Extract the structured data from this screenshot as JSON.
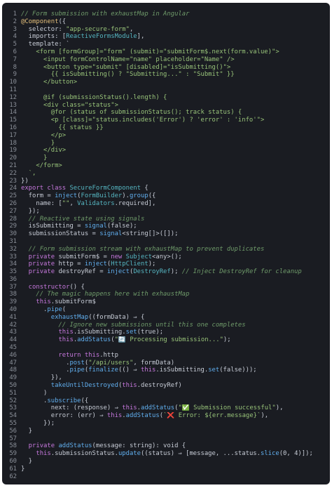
{
  "editor": {
    "lines": [
      {
        "n": "1",
        "tokens": [
          {
            "t": "// Form submission with exhaustMap in Angular",
            "c": "cm"
          }
        ]
      },
      {
        "n": "2",
        "tokens": [
          {
            "t": "@Component",
            "c": "dc"
          },
          {
            "t": "({",
            "c": "pl"
          }
        ]
      },
      {
        "n": "3",
        "tokens": [
          {
            "t": "  selector: ",
            "c": "pl"
          },
          {
            "t": "\"app-secure-form\"",
            "c": "st"
          },
          {
            "t": ",",
            "c": "pl"
          }
        ]
      },
      {
        "n": "4",
        "tokens": [
          {
            "t": "  imports: [",
            "c": "pl"
          },
          {
            "t": "ReactiveFormsModule",
            "c": "ty"
          },
          {
            "t": "],",
            "c": "pl"
          }
        ]
      },
      {
        "n": "5",
        "tokens": [
          {
            "t": "  template: `",
            "c": "pl"
          }
        ]
      },
      {
        "n": "6",
        "tokens": [
          {
            "t": "    <form [formGroup]=\"form\" (submit)=\"submitForm$.next(form.value)\">",
            "c": "st"
          }
        ]
      },
      {
        "n": "7",
        "tokens": [
          {
            "t": "      <input formControlName=\"name\" placeholder=\"Name\" />",
            "c": "st"
          }
        ]
      },
      {
        "n": "8",
        "tokens": [
          {
            "t": "      <button type=\"submit\" [disabled]=\"isSubmitting()\">",
            "c": "st"
          }
        ]
      },
      {
        "n": "9",
        "tokens": [
          {
            "t": "        {{ isSubmitting() ? \"Submitting...\" : \"Submit\" }}",
            "c": "st"
          }
        ]
      },
      {
        "n": "10",
        "tokens": [
          {
            "t": "      </button>",
            "c": "st"
          }
        ]
      },
      {
        "n": "11",
        "tokens": [
          {
            "t": "",
            "c": "pl"
          }
        ]
      },
      {
        "n": "12",
        "tokens": [
          {
            "t": "      @if (submissionStatus().length) {",
            "c": "st"
          }
        ]
      },
      {
        "n": "13",
        "tokens": [
          {
            "t": "      <div class=\"status\">",
            "c": "st"
          }
        ]
      },
      {
        "n": "14",
        "tokens": [
          {
            "t": "        @for (status of submissionStatus(); track status) {",
            "c": "st"
          }
        ]
      },
      {
        "n": "15",
        "tokens": [
          {
            "t": "        <p [class]=\"status.includes('Error') ? 'error' : 'info'\">",
            "c": "st"
          }
        ]
      },
      {
        "n": "16",
        "tokens": [
          {
            "t": "          {{ status }}",
            "c": "st"
          }
        ]
      },
      {
        "n": "17",
        "tokens": [
          {
            "t": "        </p>",
            "c": "st"
          }
        ]
      },
      {
        "n": "18",
        "tokens": [
          {
            "t": "        }",
            "c": "st"
          }
        ]
      },
      {
        "n": "19",
        "tokens": [
          {
            "t": "      </div>",
            "c": "st"
          }
        ]
      },
      {
        "n": "20",
        "tokens": [
          {
            "t": "      }",
            "c": "st"
          }
        ]
      },
      {
        "n": "21",
        "tokens": [
          {
            "t": "    </form>",
            "c": "st"
          }
        ]
      },
      {
        "n": "22",
        "tokens": [
          {
            "t": "  `,",
            "c": "st"
          }
        ]
      },
      {
        "n": "23",
        "tokens": [
          {
            "t": "})",
            "c": "pl"
          }
        ]
      },
      {
        "n": "24",
        "tokens": [
          {
            "t": "export class ",
            "c": "kw"
          },
          {
            "t": "SecureFormComponent",
            "c": "ty"
          },
          {
            "t": " {",
            "c": "pl"
          }
        ]
      },
      {
        "n": "25",
        "tokens": [
          {
            "t": "  form = ",
            "c": "pl"
          },
          {
            "t": "inject",
            "c": "fn"
          },
          {
            "t": "(",
            "c": "pl"
          },
          {
            "t": "FormBuilder",
            "c": "ty"
          },
          {
            "t": ").",
            "c": "pl"
          },
          {
            "t": "group",
            "c": "fn"
          },
          {
            "t": "({",
            "c": "pl"
          }
        ]
      },
      {
        "n": "26",
        "tokens": [
          {
            "t": "    name: [",
            "c": "pl"
          },
          {
            "t": "\"\"",
            "c": "st"
          },
          {
            "t": ", ",
            "c": "pl"
          },
          {
            "t": "Validators",
            "c": "ty"
          },
          {
            "t": ".required],",
            "c": "pl"
          }
        ]
      },
      {
        "n": "27",
        "tokens": [
          {
            "t": "  });",
            "c": "pl"
          }
        ]
      },
      {
        "n": "28",
        "tokens": [
          {
            "t": "  // Reactive state using signals",
            "c": "cm"
          }
        ]
      },
      {
        "n": "29",
        "tokens": [
          {
            "t": "  isSubmitting = ",
            "c": "pl"
          },
          {
            "t": "signal",
            "c": "fn"
          },
          {
            "t": "(false);",
            "c": "pl"
          }
        ]
      },
      {
        "n": "30",
        "tokens": [
          {
            "t": "  submissionStatus = ",
            "c": "pl"
          },
          {
            "t": "signal",
            "c": "fn"
          },
          {
            "t": "<string[]>([]);",
            "c": "pl"
          }
        ]
      },
      {
        "n": "31",
        "tokens": [
          {
            "t": "",
            "c": "pl"
          }
        ]
      },
      {
        "n": "32",
        "tokens": [
          {
            "t": "  // Form submission stream with exhaustMap to prevent duplicates",
            "c": "cm"
          }
        ]
      },
      {
        "n": "33",
        "tokens": [
          {
            "t": "  private ",
            "c": "kw"
          },
          {
            "t": "submitForm$ = ",
            "c": "pl"
          },
          {
            "t": "new ",
            "c": "kw"
          },
          {
            "t": "Subject",
            "c": "ty"
          },
          {
            "t": "<any>();",
            "c": "pl"
          }
        ]
      },
      {
        "n": "34",
        "tokens": [
          {
            "t": "  private ",
            "c": "kw"
          },
          {
            "t": "http = ",
            "c": "pl"
          },
          {
            "t": "inject",
            "c": "fn"
          },
          {
            "t": "(",
            "c": "pl"
          },
          {
            "t": "HttpClient",
            "c": "ty"
          },
          {
            "t": ");",
            "c": "pl"
          }
        ]
      },
      {
        "n": "35",
        "tokens": [
          {
            "t": "  private ",
            "c": "kw"
          },
          {
            "t": "destroyRef = ",
            "c": "pl"
          },
          {
            "t": "inject",
            "c": "fn"
          },
          {
            "t": "(",
            "c": "pl"
          },
          {
            "t": "DestroyRef",
            "c": "ty"
          },
          {
            "t": "); ",
            "c": "pl"
          },
          {
            "t": "// Inject DestroyRef for cleanup",
            "c": "cm"
          }
        ]
      },
      {
        "n": "36",
        "tokens": [
          {
            "t": "",
            "c": "pl"
          }
        ]
      },
      {
        "n": "37",
        "tokens": [
          {
            "t": "  constructor",
            "c": "kw"
          },
          {
            "t": "() {",
            "c": "pl"
          }
        ]
      },
      {
        "n": "38",
        "tokens": [
          {
            "t": "    // The magic happens here with exhaustMap",
            "c": "cm"
          }
        ]
      },
      {
        "n": "39",
        "tokens": [
          {
            "t": "    ",
            "c": "pl"
          },
          {
            "t": "this",
            "c": "kw"
          },
          {
            "t": ".submitForm$",
            "c": "pl"
          }
        ]
      },
      {
        "n": "40",
        "tokens": [
          {
            "t": "      .",
            "c": "pl"
          },
          {
            "t": "pipe",
            "c": "fn"
          },
          {
            "t": "(",
            "c": "pl"
          }
        ]
      },
      {
        "n": "41",
        "tokens": [
          {
            "t": "        ",
            "c": "pl"
          },
          {
            "t": "exhaustMap",
            "c": "fn"
          },
          {
            "t": "((formData) ⇒ {",
            "c": "pl"
          }
        ]
      },
      {
        "n": "42",
        "tokens": [
          {
            "t": "          // Ignore new submissions until this one completes",
            "c": "cm"
          }
        ]
      },
      {
        "n": "43",
        "tokens": [
          {
            "t": "          ",
            "c": "pl"
          },
          {
            "t": "this",
            "c": "kw"
          },
          {
            "t": ".isSubmitting.",
            "c": "pl"
          },
          {
            "t": "set",
            "c": "fn"
          },
          {
            "t": "(true);",
            "c": "pl"
          }
        ]
      },
      {
        "n": "44",
        "tokens": [
          {
            "t": "          ",
            "c": "pl"
          },
          {
            "t": "this",
            "c": "kw"
          },
          {
            "t": ".",
            "c": "pl"
          },
          {
            "t": "addStatus",
            "c": "fn"
          },
          {
            "t": "(",
            "c": "pl"
          },
          {
            "t": "\"🔄 Processing submission...\"",
            "c": "st"
          },
          {
            "t": ");",
            "c": "pl"
          }
        ]
      },
      {
        "n": "45",
        "tokens": [
          {
            "t": "",
            "c": "pl"
          }
        ]
      },
      {
        "n": "46",
        "tokens": [
          {
            "t": "          return ",
            "c": "kw"
          },
          {
            "t": "this",
            "c": "kw"
          },
          {
            "t": ".http",
            "c": "pl"
          }
        ]
      },
      {
        "n": "47",
        "tokens": [
          {
            "t": "            .",
            "c": "pl"
          },
          {
            "t": "post",
            "c": "fn"
          },
          {
            "t": "(",
            "c": "pl"
          },
          {
            "t": "\"/api/users\"",
            "c": "st"
          },
          {
            "t": ", formData)",
            "c": "pl"
          }
        ]
      },
      {
        "n": "48",
        "tokens": [
          {
            "t": "            .",
            "c": "pl"
          },
          {
            "t": "pipe",
            "c": "fn"
          },
          {
            "t": "(",
            "c": "pl"
          },
          {
            "t": "finalize",
            "c": "fn"
          },
          {
            "t": "(() ⇒ ",
            "c": "pl"
          },
          {
            "t": "this",
            "c": "kw"
          },
          {
            "t": ".isSubmitting.",
            "c": "pl"
          },
          {
            "t": "set",
            "c": "fn"
          },
          {
            "t": "(false)));",
            "c": "pl"
          }
        ]
      },
      {
        "n": "49",
        "tokens": [
          {
            "t": "        }),",
            "c": "pl"
          }
        ]
      },
      {
        "n": "50",
        "tokens": [
          {
            "t": "        ",
            "c": "pl"
          },
          {
            "t": "takeUntilDestroyed",
            "c": "fn"
          },
          {
            "t": "(",
            "c": "pl"
          },
          {
            "t": "this",
            "c": "kw"
          },
          {
            "t": ".destroyRef)",
            "c": "pl"
          }
        ]
      },
      {
        "n": "51",
        "tokens": [
          {
            "t": "      )",
            "c": "pl"
          }
        ]
      },
      {
        "n": "52",
        "tokens": [
          {
            "t": "      .",
            "c": "pl"
          },
          {
            "t": "subscribe",
            "c": "fn"
          },
          {
            "t": "({",
            "c": "pl"
          }
        ]
      },
      {
        "n": "53",
        "tokens": [
          {
            "t": "        next: (response) ⇒ ",
            "c": "pl"
          },
          {
            "t": "this",
            "c": "kw"
          },
          {
            "t": ".",
            "c": "pl"
          },
          {
            "t": "addStatus",
            "c": "fn"
          },
          {
            "t": "(",
            "c": "pl"
          },
          {
            "t": "\"✅ Submission successful\"",
            "c": "st"
          },
          {
            "t": "),",
            "c": "pl"
          }
        ]
      },
      {
        "n": "54",
        "tokens": [
          {
            "t": "        error: (err) ⇒ ",
            "c": "pl"
          },
          {
            "t": "this",
            "c": "kw"
          },
          {
            "t": ".",
            "c": "pl"
          },
          {
            "t": "addStatus",
            "c": "fn"
          },
          {
            "t": "(",
            "c": "pl"
          },
          {
            "t": "`❌ Error: ${err.message}`",
            "c": "st"
          },
          {
            "t": "),",
            "c": "pl"
          }
        ]
      },
      {
        "n": "55",
        "tokens": [
          {
            "t": "      });",
            "c": "pl"
          }
        ]
      },
      {
        "n": "56",
        "tokens": [
          {
            "t": "  }",
            "c": "pl"
          }
        ]
      },
      {
        "n": "57",
        "tokens": [
          {
            "t": "",
            "c": "pl"
          }
        ]
      },
      {
        "n": "58",
        "tokens": [
          {
            "t": "  private ",
            "c": "kw"
          },
          {
            "t": "addStatus",
            "c": "fn"
          },
          {
            "t": "(message: string): void {",
            "c": "pl"
          }
        ]
      },
      {
        "n": "59",
        "tokens": [
          {
            "t": "    ",
            "c": "pl"
          },
          {
            "t": "this",
            "c": "kw"
          },
          {
            "t": ".submissionStatus.",
            "c": "pl"
          },
          {
            "t": "update",
            "c": "fn"
          },
          {
            "t": "((status) ⇒ [message, ...status.",
            "c": "pl"
          },
          {
            "t": "slice",
            "c": "fn"
          },
          {
            "t": "(0, 4)]);",
            "c": "pl"
          }
        ]
      },
      {
        "n": "60",
        "tokens": [
          {
            "t": "  }",
            "c": "pl"
          }
        ]
      },
      {
        "n": "61",
        "tokens": [
          {
            "t": "}",
            "c": "pl"
          }
        ]
      },
      {
        "n": "62",
        "tokens": [
          {
            "t": "",
            "c": "pl"
          }
        ]
      }
    ]
  }
}
